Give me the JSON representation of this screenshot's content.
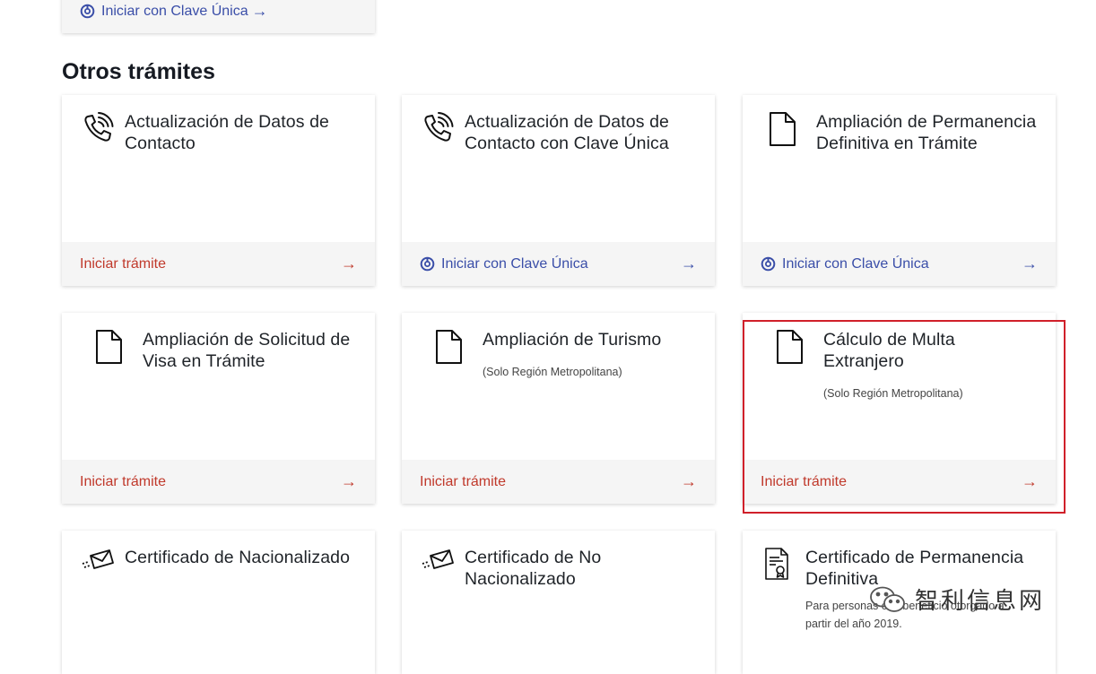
{
  "top_card": {
    "link_label": "Iniciar con Clave Única",
    "arrow": "→"
  },
  "section": {
    "title": "Otros trámites"
  },
  "cards": [
    {
      "title": "Actualización de Datos de Contacto",
      "icon": "phone-icon",
      "action": "Iniciar trámite",
      "arrow": "→"
    },
    {
      "title": "Actualización de Datos de Contacto con Clave Única",
      "icon": "phone-icon",
      "action": "Iniciar con Clave Única",
      "arrow": "→"
    },
    {
      "title": "Ampliación de Permanencia Definitiva en Trámite",
      "icon": "document-icon",
      "action": "Iniciar con Clave Única",
      "arrow": "→"
    },
    {
      "title": "Ampliación de Solicitud de Visa en Trámite",
      "icon": "document-icon",
      "action": "Iniciar trámite",
      "arrow": "→"
    },
    {
      "title": "Ampliación de Turismo",
      "subtitle": "(Solo Región Metropolitana)",
      "icon": "document-icon",
      "action": "Iniciar trámite",
      "arrow": "→"
    },
    {
      "title": "Cálculo de Multa Extranjero",
      "subtitle": "(Solo Región Metropolitana)",
      "icon": "document-icon",
      "action": "Iniciar trámite",
      "arrow": "→"
    },
    {
      "title": "Certificado de Nacionalizado",
      "icon": "envelope-icon"
    },
    {
      "title": "Certificado de No Nacionalizado",
      "icon": "envelope-icon"
    },
    {
      "title": "Certificado de Permanencia Definitiva",
      "subtitle": "Para personas con beneficio otorgado a partir del año 2019.",
      "icon": "certificate-icon"
    }
  ],
  "watermark": {
    "text": "智利信息网"
  },
  "colors": {
    "action_red": "#c0392b",
    "clave_blue": "#3a4ea8",
    "highlight": "#d0202a"
  }
}
